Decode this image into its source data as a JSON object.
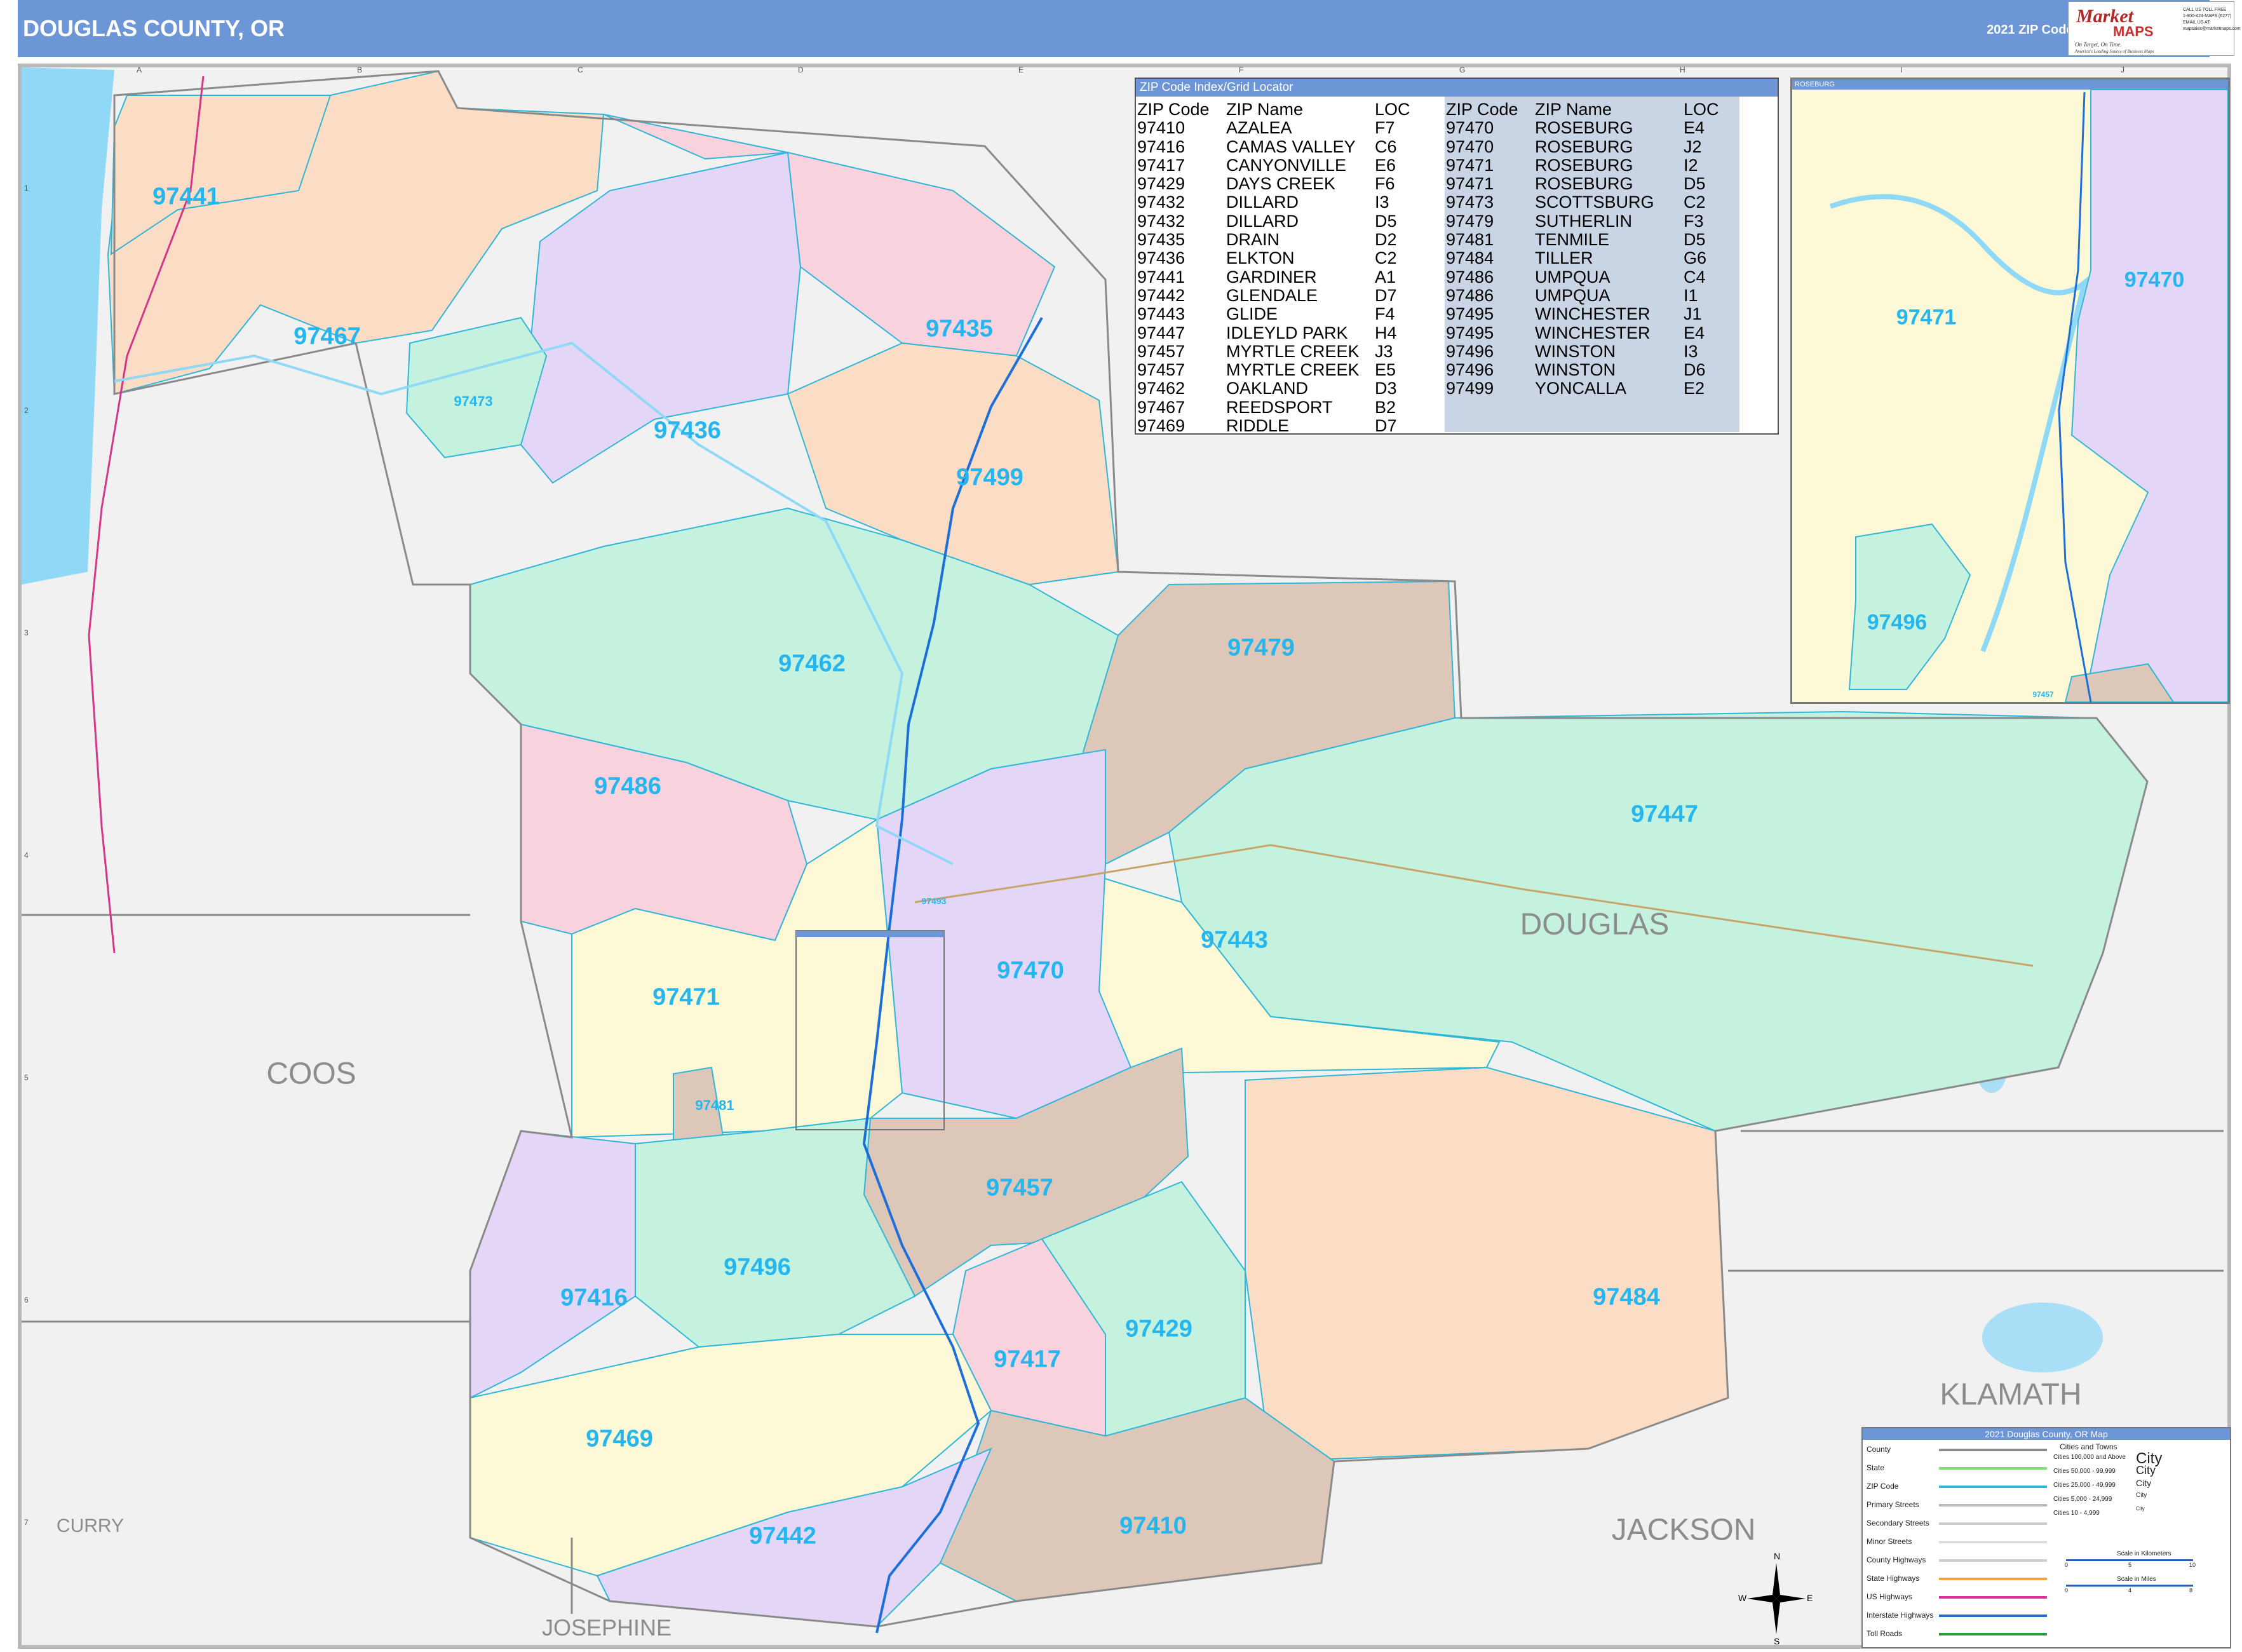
{
  "header": {
    "title": "DOUGLAS COUNTY, OR",
    "edition": "2021 ZIP Code ColorCast Edition"
  },
  "logo": {
    "brand_top": "Market",
    "brand_bottom": "MAPS",
    "tagline": "On Target, On Time.",
    "subtagline": "America's Leading Source of Business Maps",
    "contact": "CALL US TOLL FREE\n1-800-424-MAPS (6277)\nEMAIL US AT:\nmapsales@marketmaps.com"
  },
  "map": {
    "zip_labels": [
      "97441",
      "97467",
      "97473",
      "97436",
      "97435",
      "97499",
      "97462",
      "97479",
      "97486",
      "97447",
      "97443",
      "97470",
      "97471",
      "97481",
      "97457",
      "97496",
      "97416",
      "97429",
      "97417",
      "97484",
      "97469",
      "97410",
      "97442",
      "97493"
    ],
    "county_labels": [
      "DOUGLAS",
      "COOS",
      "KLAMATH",
      "JACKSON",
      "CURRY",
      "JOSEPHINE"
    ],
    "grid_letters": [
      "A",
      "B",
      "C",
      "D",
      "E",
      "F",
      "G",
      "H",
      "I",
      "J"
    ],
    "grid_numbers": [
      "1",
      "2",
      "3",
      "4",
      "5",
      "6",
      "7"
    ],
    "colors": {
      "water": "#8fd9f6",
      "zip_label": "#26b6ef",
      "boundary": "#2fb6d8",
      "county_line": "#8a8a8a",
      "interstate": "#1c6fd9",
      "peach": "#fbdcc5",
      "lavender": "#e4d6f6",
      "pink": "#f8d2dd",
      "mint": "#c4f2de",
      "taupe": "#dcc7b8",
      "cream": "#fdf8d6",
      "outside": "#f1f1f1"
    }
  },
  "zip_index": {
    "header": "ZIP Code Index/Grid Locator",
    "columns": [
      "ZIP Code",
      "ZIP Name",
      "LOC"
    ],
    "left": [
      [
        "97410",
        "AZALEA",
        "F7"
      ],
      [
        "97416",
        "CAMAS VALLEY",
        "C6"
      ],
      [
        "97417",
        "CANYONVILLE",
        "E6"
      ],
      [
        "97429",
        "DAYS CREEK",
        "F6"
      ],
      [
        "97432",
        "DILLARD",
        "I3"
      ],
      [
        "97432",
        "DILLARD",
        "D5"
      ],
      [
        "97435",
        "DRAIN",
        "D2"
      ],
      [
        "97436",
        "ELKTON",
        "C2"
      ],
      [
        "97441",
        "GARDINER",
        "A1"
      ],
      [
        "97442",
        "GLENDALE",
        "D7"
      ],
      [
        "97443",
        "GLIDE",
        "F4"
      ],
      [
        "97447",
        "IDLEYLD PARK",
        "H4"
      ],
      [
        "97457",
        "MYRTLE CREEK",
        "J3"
      ],
      [
        "97457",
        "MYRTLE CREEK",
        "E5"
      ],
      [
        "97462",
        "OAKLAND",
        "D3"
      ],
      [
        "97467",
        "REEDSPORT",
        "B2"
      ],
      [
        "97469",
        "RIDDLE",
        "D7"
      ]
    ],
    "right": [
      [
        "97470",
        "ROSEBURG",
        "E4"
      ],
      [
        "97470",
        "ROSEBURG",
        "J2"
      ],
      [
        "97471",
        "ROSEBURG",
        "I2"
      ],
      [
        "97471",
        "ROSEBURG",
        "D5"
      ],
      [
        "97473",
        "SCOTTSBURG",
        "C2"
      ],
      [
        "97479",
        "SUTHERLIN",
        "F3"
      ],
      [
        "97481",
        "TENMILE",
        "D5"
      ],
      [
        "97484",
        "TILLER",
        "G6"
      ],
      [
        "97486",
        "UMPQUA",
        "C4"
      ],
      [
        "97486",
        "UMPQUA",
        "I1"
      ],
      [
        "97495",
        "WINCHESTER",
        "J1"
      ],
      [
        "97495",
        "WINCHESTER",
        "E4"
      ],
      [
        "97496",
        "WINSTON",
        "I3"
      ],
      [
        "97496",
        "WINSTON",
        "D6"
      ],
      [
        "97499",
        "YONCALLA",
        "E2"
      ]
    ]
  },
  "inset": {
    "title": "ROSEBURG",
    "zip_labels": [
      "97470",
      "97471",
      "97496",
      "97457"
    ],
    "boundary_label": "ROSEBURG"
  },
  "legend": {
    "title": "2021 Douglas County, OR Map",
    "items": [
      "County",
      "State",
      "ZIP Code",
      "Primary Streets",
      "Secondary Streets",
      "Minor Streets",
      "County Highways",
      "State Highways",
      "US Highways",
      "Interstate Highways",
      "Toll Roads"
    ],
    "cities_title": "Cities and Towns",
    "city_classes": [
      [
        "Cities 100,000 and Above",
        "City"
      ],
      [
        "Cities 50,000 - 99,999",
        "City"
      ],
      [
        "Cities 25,000 - 49,999",
        "City"
      ],
      [
        "Cities 5,000 - 24,999",
        "City"
      ],
      [
        "Cities 10 - 4,999",
        "City"
      ]
    ],
    "scale_km": "Scale in Kilometers",
    "scale_mi": "Scale in Miles",
    "km_ticks": [
      "0",
      "5",
      "10"
    ],
    "mi_ticks": [
      "0",
      "4",
      "8"
    ]
  },
  "compass": {
    "n": "N",
    "s": "S",
    "e": "E",
    "w": "W"
  }
}
